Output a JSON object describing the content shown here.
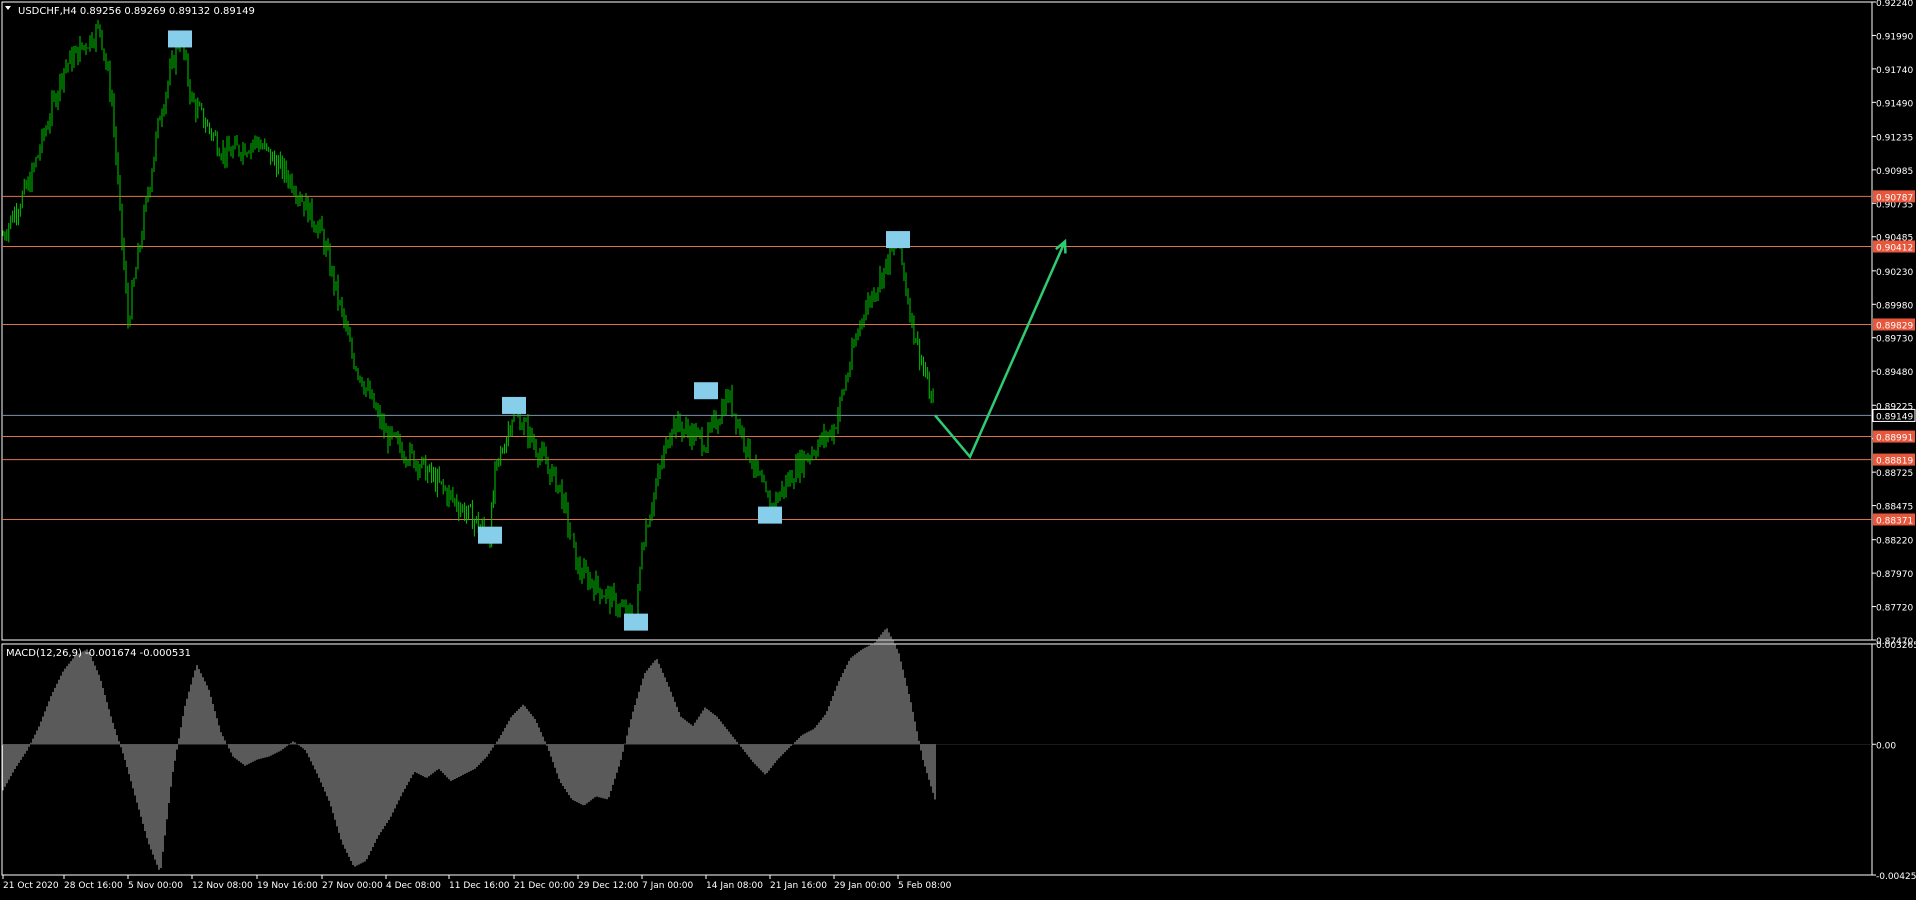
{
  "price_panel": {
    "header_text": "USDCHF,H4  0.89256 0.89269 0.89132 0.89149"
  },
  "macd_panel": {
    "header_text": "MACD(12,26,9) -0.001674 -0.000531",
    "axis_labels": [
      "0.003265",
      "0.00",
      "-0.004258"
    ]
  },
  "colors": {
    "background": "#000000",
    "candles": "#00c800",
    "level_line": "#e0704c",
    "current_line": "#7b93a8",
    "marker": "#87ceeb",
    "projection": "#2ecc71",
    "macd_hist": "#b4b4b4",
    "axis_text": "#ffffff",
    "level_label_bg": "#e8573c",
    "frame": "#ffffff"
  },
  "chart_data": [
    {
      "type": "line",
      "chart_kind": "candlestick (rendered as OHLC bars)",
      "symbol": "USDCHF",
      "timeframe": "H4",
      "ylim": [
        0.8747,
        0.9224
      ],
      "y_ticks": [
        0.9224,
        0.9199,
        0.9174,
        0.9149,
        0.91235,
        0.90985,
        0.90735,
        0.90485,
        0.9023,
        0.8998,
        0.8973,
        0.8948,
        0.89225,
        0.88975,
        0.88725,
        0.88475,
        0.8822,
        0.8797,
        0.8772,
        0.8747
      ],
      "x_tick_labels": [
        "21 Oct 2020",
        "28 Oct 16:00",
        "5 Nov 00:00",
        "12 Nov 08:00",
        "19 Nov 16:00",
        "27 Nov 00:00",
        "4 Dec 08:00",
        "11 Dec 16:00",
        "21 Dec 00:00",
        "29 Dec 12:00",
        "7 Jan 00:00",
        "14 Jan 08:00",
        "21 Jan 16:00",
        "29 Jan 00:00",
        "5 Feb 08:00"
      ],
      "price_path": [
        {
          "t": "21 Oct 2020",
          "price": 0.905
        },
        {
          "t": "24 Oct",
          "price": 0.909
        },
        {
          "t": "28 Oct 16:00",
          "price": 0.9175
        },
        {
          "t": "29 Oct",
          "price": 0.9205
        },
        {
          "t": "31 Oct",
          "price": 0.915
        },
        {
          "t": "3 Nov",
          "price": 0.9065
        },
        {
          "t": "5 Nov 00:00",
          "price": 0.8985
        },
        {
          "t": "6 Nov",
          "price": 0.914
        },
        {
          "t": "9 Nov",
          "price": 0.92
        },
        {
          "t": "12 Nov 08:00",
          "price": 0.915
        },
        {
          "t": "15 Nov",
          "price": 0.911
        },
        {
          "t": "19 Nov 16:00",
          "price": 0.912
        },
        {
          "t": "23 Nov",
          "price": 0.909
        },
        {
          "t": "27 Nov 00:00",
          "price": 0.905
        },
        {
          "t": "1 Dec",
          "price": 0.896
        },
        {
          "t": "4 Dec 08:00",
          "price": 0.89
        },
        {
          "t": "8 Dec",
          "price": 0.888
        },
        {
          "t": "11 Dec 16:00",
          "price": 0.8855
        },
        {
          "t": "14 Dec",
          "price": 0.8825
        },
        {
          "t": "17 Dec",
          "price": 0.887
        },
        {
          "t": "21 Dec 00:00",
          "price": 0.892
        },
        {
          "t": "24 Dec",
          "price": 0.886
        },
        {
          "t": "29 Dec 12:00",
          "price": 0.88
        },
        {
          "t": "6 Jan",
          "price": 0.876
        },
        {
          "t": "7 Jan 00:00",
          "price": 0.882
        },
        {
          "t": "9 Jan",
          "price": 0.891
        },
        {
          "t": "14 Jan 08:00",
          "price": 0.8895
        },
        {
          "t": "16 Jan",
          "price": 0.893
        },
        {
          "t": "21 Jan 16:00",
          "price": 0.8845
        },
        {
          "t": "25 Jan",
          "price": 0.888
        },
        {
          "t": "29 Jan 00:00",
          "price": 0.8905
        },
        {
          "t": "2 Feb",
          "price": 0.899
        },
        {
          "t": "5 Feb 08:00",
          "price": 0.9045
        },
        {
          "t": "7 Feb",
          "price": 0.8985
        },
        {
          "t": "9 Feb",
          "price": 0.8915
        }
      ],
      "horizontal_levels": [
        {
          "price": 0.90787,
          "label": "0.90787",
          "style": "level"
        },
        {
          "price": 0.90412,
          "label": "0.90412",
          "style": "level"
        },
        {
          "price": 0.89829,
          "label": "0.89829",
          "style": "level"
        },
        {
          "price": 0.89149,
          "label": "0.89149",
          "style": "current"
        },
        {
          "price": 0.88991,
          "label": "0.88991",
          "style": "level"
        },
        {
          "price": 0.88819,
          "label": "0.88819",
          "style": "level"
        },
        {
          "price": 0.88371,
          "label": "0.88371",
          "style": "level"
        }
      ],
      "markers": [
        {
          "t": "9 Nov",
          "price": 0.9196
        },
        {
          "t": "14 Dec",
          "price": 0.8825
        },
        {
          "t": "21 Dec 00:00",
          "price": 0.8922
        },
        {
          "t": "6 Jan",
          "price": 0.876
        },
        {
          "t": "14 Jan 08:00",
          "price": 0.8933
        },
        {
          "t": "21 Jan 16:00",
          "price": 0.884
        },
        {
          "t": "5 Feb 08:00",
          "price": 0.9046
        }
      ],
      "projection": [
        {
          "t": "9 Feb",
          "price": 0.8915
        },
        {
          "t": "11 Feb",
          "price": 0.8884
        },
        {
          "t": "17 Feb",
          "price": 0.9045
        }
      ]
    },
    {
      "type": "bar",
      "name": "MACD(12,26,9)",
      "ylim": [
        -0.004258,
        0.003265
      ],
      "y_ticks": [
        0.003265,
        0.0,
        -0.004258
      ],
      "values": [
        -0.0015,
        -0.0008,
        -0.0002,
        0.0006,
        0.0016,
        0.0024,
        0.0029,
        0.0031,
        0.0022,
        0.0008,
        -0.0004,
        -0.0018,
        -0.0032,
        -0.0042,
        -0.001,
        0.0012,
        0.0026,
        0.0018,
        0.0004,
        -0.0004,
        -0.0007,
        -0.0005,
        -0.0004,
        -0.0002,
        0.0001,
        -0.0002,
        -0.001,
        -0.0019,
        -0.0032,
        -0.004,
        -0.0038,
        -0.003,
        -0.0024,
        -0.0016,
        -0.0009,
        -0.0011,
        -0.0008,
        -0.0012,
        -0.001,
        -0.0008,
        -0.0004,
        0.0002,
        0.0009,
        0.0013,
        0.0008,
        -0.0001,
        -0.0012,
        -0.0018,
        -0.002,
        -0.0017,
        -0.0018,
        -0.0006,
        0.001,
        0.0023,
        0.0028,
        0.0019,
        0.0009,
        0.0006,
        0.0012,
        0.0009,
        0.0004,
        -0.0001,
        -0.0006,
        -0.001,
        -0.0005,
        -0.0001,
        0.0003,
        0.0005,
        0.001,
        0.002,
        0.0028,
        0.0031,
        0.0033,
        0.0038,
        0.003,
        0.0014,
        -0.0005,
        -0.0018
      ]
    }
  ]
}
